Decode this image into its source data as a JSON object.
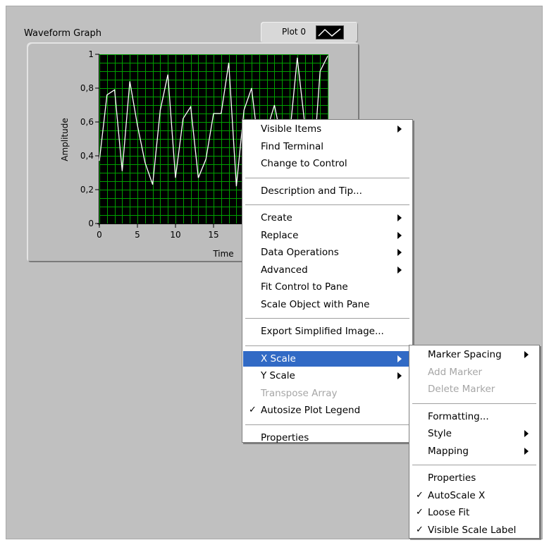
{
  "graph": {
    "label": "Waveform Graph",
    "legend_name": "Plot 0",
    "plot_bg": "#000000",
    "grid_color": "#00a000",
    "trace_color": "#ffffff"
  },
  "chart_data": {
    "type": "line",
    "xlabel": "Time",
    "ylabel": "Amplitude",
    "xlim": [
      0,
      30
    ],
    "ylim": [
      0,
      1
    ],
    "x_ticks": [
      "0",
      "5",
      "10",
      "15"
    ],
    "y_ticks": [
      "0",
      "0,2",
      "0,4",
      "0,6",
      "0,8",
      "1"
    ],
    "series": [
      {
        "name": "Plot 0",
        "x": [
          0,
          1,
          2,
          3,
          4,
          5,
          6,
          7,
          8,
          9,
          10,
          11,
          12,
          13,
          14,
          15,
          16,
          17,
          18,
          19,
          20,
          21,
          22,
          23,
          24,
          25,
          26,
          27,
          28,
          29,
          30
        ],
        "values": [
          0.37,
          0.76,
          0.79,
          0.31,
          0.84,
          0.58,
          0.36,
          0.23,
          0.67,
          0.88,
          0.27,
          0.62,
          0.69,
          0.27,
          0.38,
          0.65,
          0.65,
          0.95,
          0.22,
          0.67,
          0.8,
          0.42,
          0.55,
          0.7,
          0.48,
          0.52,
          0.98,
          0.58,
          0.27,
          0.9,
          0.99
        ]
      }
    ]
  },
  "context_menu": {
    "items": [
      {
        "label": "Visible Items",
        "submenu": true
      },
      {
        "label": "Find Terminal"
      },
      {
        "label": "Change to Control"
      },
      {
        "sep": true
      },
      {
        "label": "Description and Tip..."
      },
      {
        "sep": true
      },
      {
        "label": "Create",
        "submenu": true
      },
      {
        "label": "Replace",
        "submenu": true
      },
      {
        "label": "Data Operations",
        "submenu": true
      },
      {
        "label": "Advanced",
        "submenu": true
      },
      {
        "label": "Fit Control to Pane"
      },
      {
        "label": "Scale Object with Pane"
      },
      {
        "sep": true
      },
      {
        "label": "Export Simplified Image..."
      },
      {
        "sep": true
      },
      {
        "label": "X Scale",
        "submenu": true,
        "highlighted": true
      },
      {
        "label": "Y Scale",
        "submenu": true
      },
      {
        "label": "Transpose Array",
        "disabled": true
      },
      {
        "label": "Autosize Plot Legend",
        "checked": true
      },
      {
        "sep": true
      },
      {
        "label": "Properties"
      }
    ]
  },
  "x_scale_submenu": {
    "items": [
      {
        "label": "Marker Spacing",
        "submenu": true
      },
      {
        "label": "Add Marker",
        "disabled": true
      },
      {
        "label": "Delete Marker",
        "disabled": true
      },
      {
        "sep": true
      },
      {
        "label": "Formatting..."
      },
      {
        "label": "Style",
        "submenu": true
      },
      {
        "label": "Mapping",
        "submenu": true
      },
      {
        "sep": true
      },
      {
        "label": "Properties"
      },
      {
        "label": "AutoScale X",
        "checked": true
      },
      {
        "label": "Loose Fit",
        "checked": true
      },
      {
        "label": "Visible Scale Label",
        "checked": true
      }
    ]
  },
  "check_glyph": "✓",
  "colors": {
    "highlight": "#316ac5",
    "panel": "#c0c0c0",
    "disabled_text": "#a6a6a6"
  }
}
